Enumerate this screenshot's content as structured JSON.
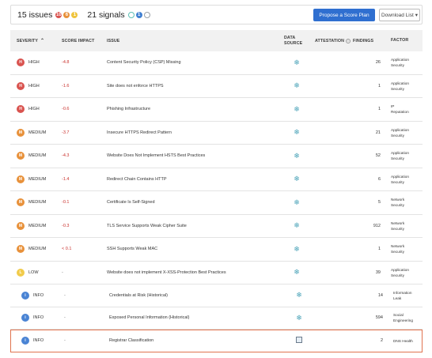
{
  "summary": {
    "issues_label": "15 issues",
    "issue_counts": {
      "high": "10",
      "medium": "6",
      "low": "1"
    },
    "signals_label": "21 signals",
    "signal_counts": {
      "positive": "",
      "info": "1",
      "neutral": ""
    },
    "propose_button": "Propose a Score Plan",
    "download_button": "Download List"
  },
  "columns": {
    "severity": "SEVERITY",
    "score_impact": "SCORE IMPACT",
    "issue": "ISSUE",
    "data_source_line1": "DATA",
    "data_source_line2": "SOURCE",
    "attestation": "ATTESTATION",
    "findings": "FINDINGS",
    "factor": "FACTOR"
  },
  "rows": [
    {
      "severity": "HIGH",
      "level": "high",
      "impact": "-4.8",
      "issue": "Content Security Policy (CSP) Missing",
      "findings": "26",
      "factor1": "Application",
      "factor2": "Security"
    },
    {
      "severity": "HIGH",
      "level": "high",
      "impact": "-1.6",
      "issue": "Site does not enforce HTTPS",
      "findings": "1",
      "factor1": "Application",
      "factor2": "Security"
    },
    {
      "severity": "HIGH",
      "level": "high",
      "impact": "-0.6",
      "issue": "Phishing Infrastructure",
      "findings": "1",
      "factor1": "IP",
      "factor2": "Reputation"
    },
    {
      "severity": "MEDIUM",
      "level": "medium",
      "impact": "-3.7",
      "issue": "Insecure HTTPS Redirect Pattern",
      "findings": "21",
      "factor1": "Application",
      "factor2": "Security"
    },
    {
      "severity": "MEDIUM",
      "level": "medium",
      "impact": "-4.3",
      "issue": "Website Does Not Implement HSTS Best Practices",
      "findings": "52",
      "factor1": "Application",
      "factor2": "Security"
    },
    {
      "severity": "MEDIUM",
      "level": "medium",
      "impact": "-1.4",
      "issue": "Redirect Chain Contains HTTP",
      "findings": "6",
      "factor1": "Application",
      "factor2": "Security"
    },
    {
      "severity": "MEDIUM",
      "level": "medium",
      "impact": "-0.1",
      "issue": "Certificate Is Self-Signed",
      "findings": "5",
      "factor1": "Network",
      "factor2": "Security"
    },
    {
      "severity": "MEDIUM",
      "level": "medium",
      "impact": "-0.3",
      "issue": "TLS Service Supports Weak Cipher Suite",
      "findings": "912",
      "factor1": "Network",
      "factor2": "Security"
    },
    {
      "severity": "MEDIUM",
      "level": "medium",
      "impact": "< 0.1",
      "issue": "SSH Supports Weak MAC",
      "findings": "1",
      "factor1": "Network",
      "factor2": "Security"
    },
    {
      "severity": "LOW",
      "level": "low",
      "impact": "-",
      "issue": "Website does not implement X-XSS-Protection Best Practices",
      "findings": "39",
      "factor1": "Application",
      "factor2": "Security"
    }
  ],
  "info_rows": [
    {
      "severity": "INFO",
      "impact": "-",
      "issue": "Credentials at Risk (Historical)",
      "findings": "14",
      "factor1": "Information",
      "factor2": "Leak"
    },
    {
      "severity": "INFO",
      "impact": "-",
      "issue": "Exposed Personal Information (Historical)",
      "findings": "594",
      "factor1": "Social",
      "factor2": "Engineering"
    },
    {
      "severity": "INFO",
      "impact": "-",
      "issue": "Registrar Classification",
      "findings": "2",
      "factor1": "DNS Health",
      "factor2": ""
    }
  ],
  "icons": {
    "data_source": "snowflake-icon",
    "registrar_data_source": "document-icon",
    "sort": "sort-asc-icon"
  },
  "colors": {
    "high": "#d9534f",
    "medium": "#e8913a",
    "low": "#f1cb4a",
    "info": "#4a84d4",
    "primary_button": "#2f6fd0",
    "highlight_outline": "#e0734f"
  }
}
